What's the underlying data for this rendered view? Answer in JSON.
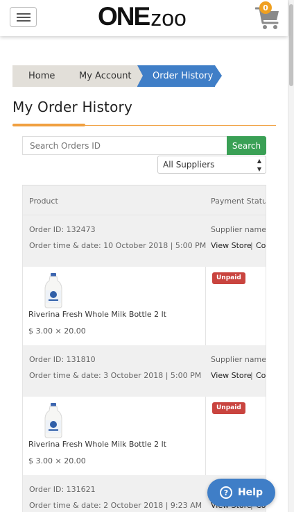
{
  "header": {
    "menu_icon": "hamburger-icon",
    "logo_bold": "ONE",
    "logo_light": "zoo",
    "cart_icon": "shopping-cart-icon",
    "cart_count": "0",
    "accent": "#f0a020"
  },
  "breadcrumb": {
    "home": "Home",
    "account": "My Account",
    "current": "Order History"
  },
  "page": {
    "title": "My Order History"
  },
  "search": {
    "placeholder": "Search Orders ID",
    "button": "Search",
    "supplier_filter": "All Suppliers"
  },
  "table": {
    "headers": {
      "product": "Product",
      "payment_status": "Payment Status"
    },
    "orders": [
      {
        "order_id": "Order ID: 132473",
        "order_time": "Order time & date: 10 October 2018 | 5:00 PM",
        "supplier_label": "Supplier name:",
        "view_store": "View Store",
        "separator": "|",
        "contact_partial": "Co",
        "product_name": "Riverina Fresh Whole Milk Bottle 2 lt",
        "price": "$ 3.00 × 20.00",
        "status": "Unpaid"
      },
      {
        "order_id": "Order ID: 131810",
        "order_time": "Order time & date: 3 October 2018 | 5:00 PM",
        "supplier_label": "Supplier name:",
        "view_store": "View Store",
        "separator": "|",
        "contact_partial": "Co",
        "product_name": "Riverina Fresh Whole Milk Bottle 2 lt",
        "price": "$ 3.00 × 20.00",
        "status": "Unpaid"
      },
      {
        "order_id": "Order ID: 131621",
        "order_time": "Order time & date: 2 October 2018 | 9:23 AM",
        "view_store": "View Store",
        "separator": "|",
        "contact_partial": "Co"
      }
    ]
  },
  "help": {
    "icon": "question-circle-icon",
    "label": "Help"
  },
  "colors": {
    "primary_blue": "#3f7ec7",
    "search_green": "#3aa055",
    "unpaid_red": "#c9443f",
    "divider_orange": "#f0a040"
  }
}
